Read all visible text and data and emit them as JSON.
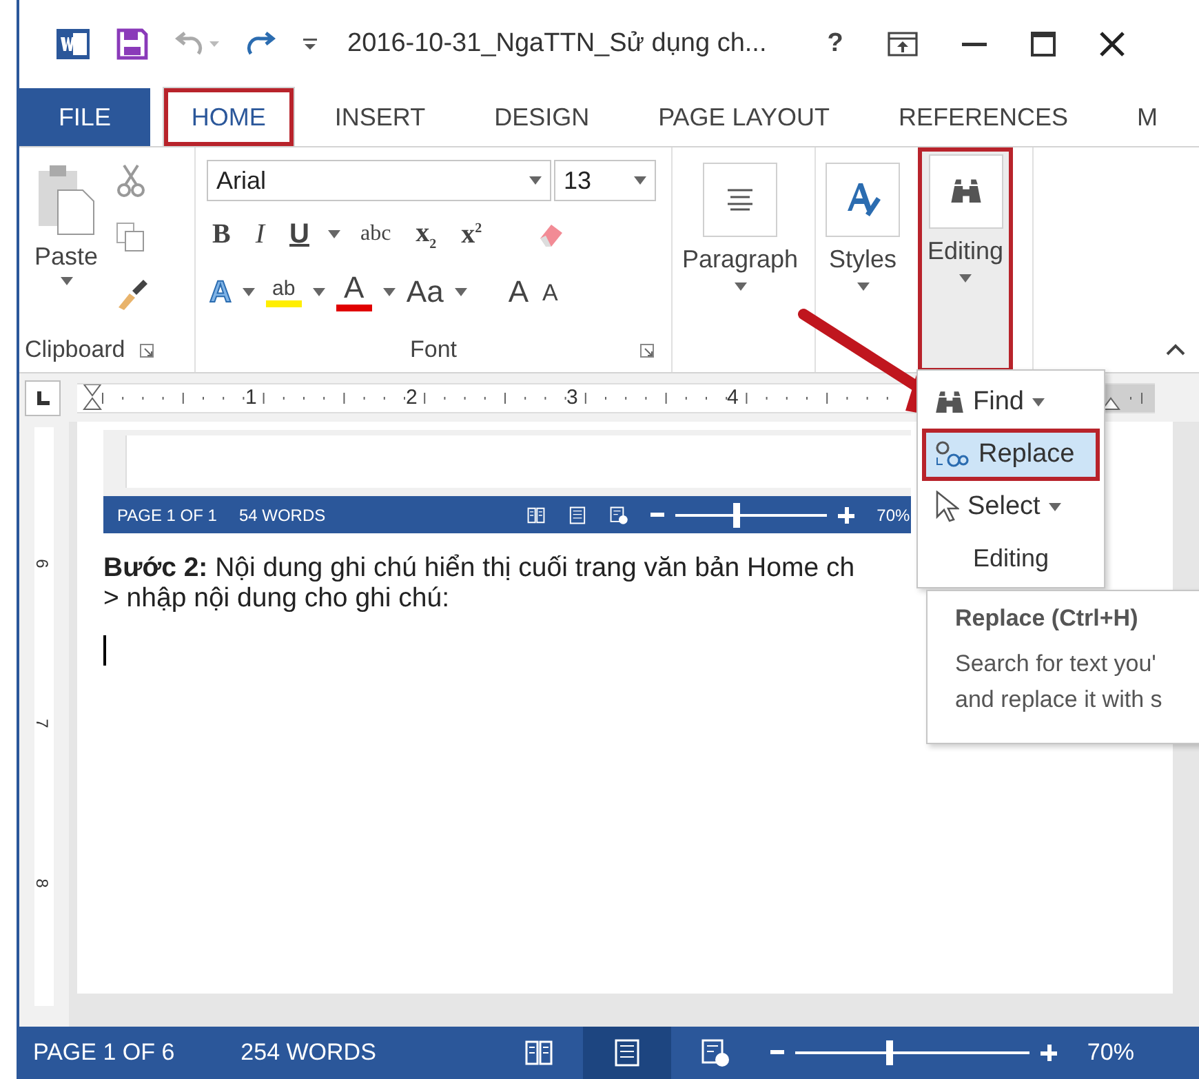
{
  "window": {
    "title": "2016-10-31_NgaTTN_Sử dụng ch...",
    "help": "?"
  },
  "tabs": [
    {
      "label": "FILE",
      "kind": "backstage",
      "selected": false,
      "annotated": false
    },
    {
      "label": "HOME",
      "kind": "tab",
      "selected": true,
      "annotated": true
    },
    {
      "label": "INSERT",
      "kind": "tab",
      "selected": false,
      "annotated": false
    },
    {
      "label": "DESIGN",
      "kind": "tab",
      "selected": false,
      "annotated": false
    },
    {
      "label": "PAGE LAYOUT",
      "kind": "tab",
      "selected": false,
      "annotated": false
    },
    {
      "label": "REFERENCES",
      "kind": "tab",
      "selected": false,
      "annotated": false
    },
    {
      "label": "M",
      "kind": "tab",
      "selected": false,
      "annotated": false
    }
  ],
  "ribbon": {
    "clipboard": {
      "paste": "Paste",
      "label": "Clipboard"
    },
    "font": {
      "font_name": "Arial",
      "font_size": "13",
      "label": "Font",
      "format_buttons": [
        {
          "text": "B",
          "kind": "bold"
        },
        {
          "text": "I",
          "kind": "italic"
        },
        {
          "text": "U",
          "kind": "underline"
        },
        {
          "text": "abc",
          "kind": "strike"
        },
        {
          "text": "x$_{2}$",
          "kind": "sub"
        },
        {
          "text": "x$^{2}$",
          "kind": "sup"
        }
      ],
      "tools": [
        {
          "kind": "effects",
          "text": "A"
        },
        {
          "kind": "highlight",
          "text": "ab",
          "color": "#ffee00"
        },
        {
          "kind": "color",
          "text": "A",
          "color": "#e00000"
        },
        {
          "kind": "case",
          "text": "Aa"
        },
        {
          "kind": "grow",
          "text": "A"
        },
        {
          "kind": "shrink",
          "text": "A"
        }
      ]
    },
    "paragraph": {
      "label": "Paragraph"
    },
    "styles": {
      "label": "Styles"
    },
    "editing": {
      "label": "Editing",
      "annotated": true
    }
  },
  "ruler": {
    "numbers": [
      "1",
      "2",
      "3",
      "4"
    ]
  },
  "vertical_ruler": {
    "numbers": [
      "6",
      "7",
      "8"
    ]
  },
  "document": {
    "embedded_screenshot": {
      "page": "PAGE 1 OF 1",
      "words": "54 WORDS",
      "zoom": {
        "level": 0.4
      },
      "zoom_text": "70%"
    },
    "paragraph": [
      "**Bước 2:** Nội dung ghi chú hiển thị cuối trang văn bản Home ch",
      "> nhập nội dung cho ghi chú:"
    ]
  },
  "editing_menu": {
    "items": [
      {
        "label": "Find",
        "kind": "find",
        "selected": false,
        "annotated": false
      },
      {
        "label": "Replace",
        "kind": "replace",
        "selected": true,
        "annotated": true
      },
      {
        "label": "Select",
        "kind": "select",
        "selected": false,
        "annotated": false
      }
    ],
    "label": "Editing"
  },
  "tooltip": {
    "title": "Replace (Ctrl+H)",
    "lines": [
      "Search for text you'",
      "and replace it with s"
    ]
  },
  "status_bar": {
    "page": "PAGE 1 OF 6",
    "words": "254 WORDS",
    "views": [
      {
        "kind": "read",
        "selected": false
      },
      {
        "kind": "print",
        "selected": true
      },
      {
        "kind": "web",
        "selected": false
      }
    ],
    "zoom": {
      "level": 0.4
    },
    "zoom_text": "70%"
  }
}
